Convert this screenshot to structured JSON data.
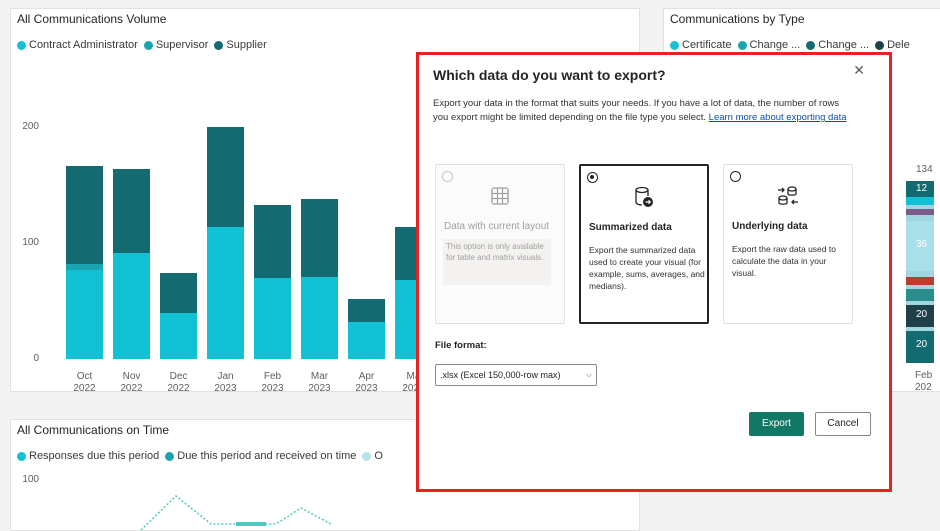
{
  "volume_panel": {
    "title": "All Communications Volume",
    "legend": [
      {
        "label": "Contract Administrator",
        "color": "#12c2d4"
      },
      {
        "label": "Supervisor",
        "color": "#1aa3b0"
      },
      {
        "label": "Supplier",
        "color": "#136a70"
      }
    ]
  },
  "chart_data": {
    "type": "bar",
    "stacked": true,
    "title": "All Communications Volume",
    "categories": [
      "Oct 2022",
      "Nov 2022",
      "Dec 2022",
      "Jan 2023",
      "Feb 2023",
      "Mar 2023",
      "Apr 2023",
      "May 2023"
    ],
    "category_lines": [
      [
        "Oct",
        "2022"
      ],
      [
        "Nov",
        "2022"
      ],
      [
        "Dec",
        "2022"
      ],
      [
        "Jan",
        "2023"
      ],
      [
        "Feb",
        "2023"
      ],
      [
        "Mar",
        "2023"
      ],
      [
        "Apr",
        "2023"
      ],
      [
        "Ma",
        "2023"
      ]
    ],
    "series": [
      {
        "name": "Contract Administrator",
        "color": "#12c2d4",
        "values": [
          77,
          91,
          40,
          114,
          70,
          71,
          32,
          68
        ]
      },
      {
        "name": "Supervisor",
        "color": "#1aa3b0",
        "values": [
          5,
          0,
          0,
          0,
          0,
          0,
          0,
          0
        ]
      },
      {
        "name": "Supplier",
        "color": "#136a70",
        "values": [
          84,
          73,
          34,
          86,
          63,
          67,
          20,
          46
        ]
      }
    ],
    "yticks": [
      "200",
      "100",
      "0"
    ],
    "ylim": [
      0,
      200
    ]
  },
  "type_panel": {
    "title": "Communications by Type",
    "legend": [
      {
        "label": "Certificate",
        "color": "#12c2d4"
      },
      {
        "label": "Change ...",
        "color": "#1aa3b0"
      },
      {
        "label": "Change ...",
        "color": "#136a70"
      },
      {
        "label": "Dele",
        "color": "#1f3f49"
      }
    ],
    "labels": [
      "134",
      "12",
      "36",
      "20",
      "20"
    ],
    "axis_label": "Feb",
    "axis_label2": "202"
  },
  "time_panel": {
    "title": "All Communications on Time",
    "legend": [
      {
        "label": "Responses due this period",
        "color": "#12c2d4"
      },
      {
        "label": "Due this period and received on time",
        "color": "#1aa3b0"
      },
      {
        "label": "O",
        "color": "#b7e4e6"
      }
    ],
    "ytick": "100"
  },
  "modal": {
    "title": "Which data do you want to export?",
    "description": "Export your data in the format that suits your needs. If you have a lot of data, the number of rows you export might be limited depending on the file type you select.",
    "learn_more": "Learn more about exporting data",
    "options": [
      {
        "title": "Data with current layout",
        "note": "This option is only available for table and matrix visuals.",
        "state": "disabled",
        "icon": "table-icon"
      },
      {
        "title": "Summarized data",
        "desc": "Export the summarized data used to create your visual (for example, sums, averages, and medians).",
        "state": "selected",
        "icon": "summarized-data-icon"
      },
      {
        "title": "Underlying data",
        "desc": "Export the raw data used to calculate the data in your visual.",
        "state": "unselected",
        "icon": "underlying-data-icon"
      }
    ],
    "file_format_label": "File format:",
    "file_format_value": ".xlsx (Excel 150,000-row max)",
    "export_label": "Export",
    "cancel_label": "Cancel"
  },
  "colors": {
    "accent": "#117865",
    "highlight_border": "#e8231f"
  }
}
